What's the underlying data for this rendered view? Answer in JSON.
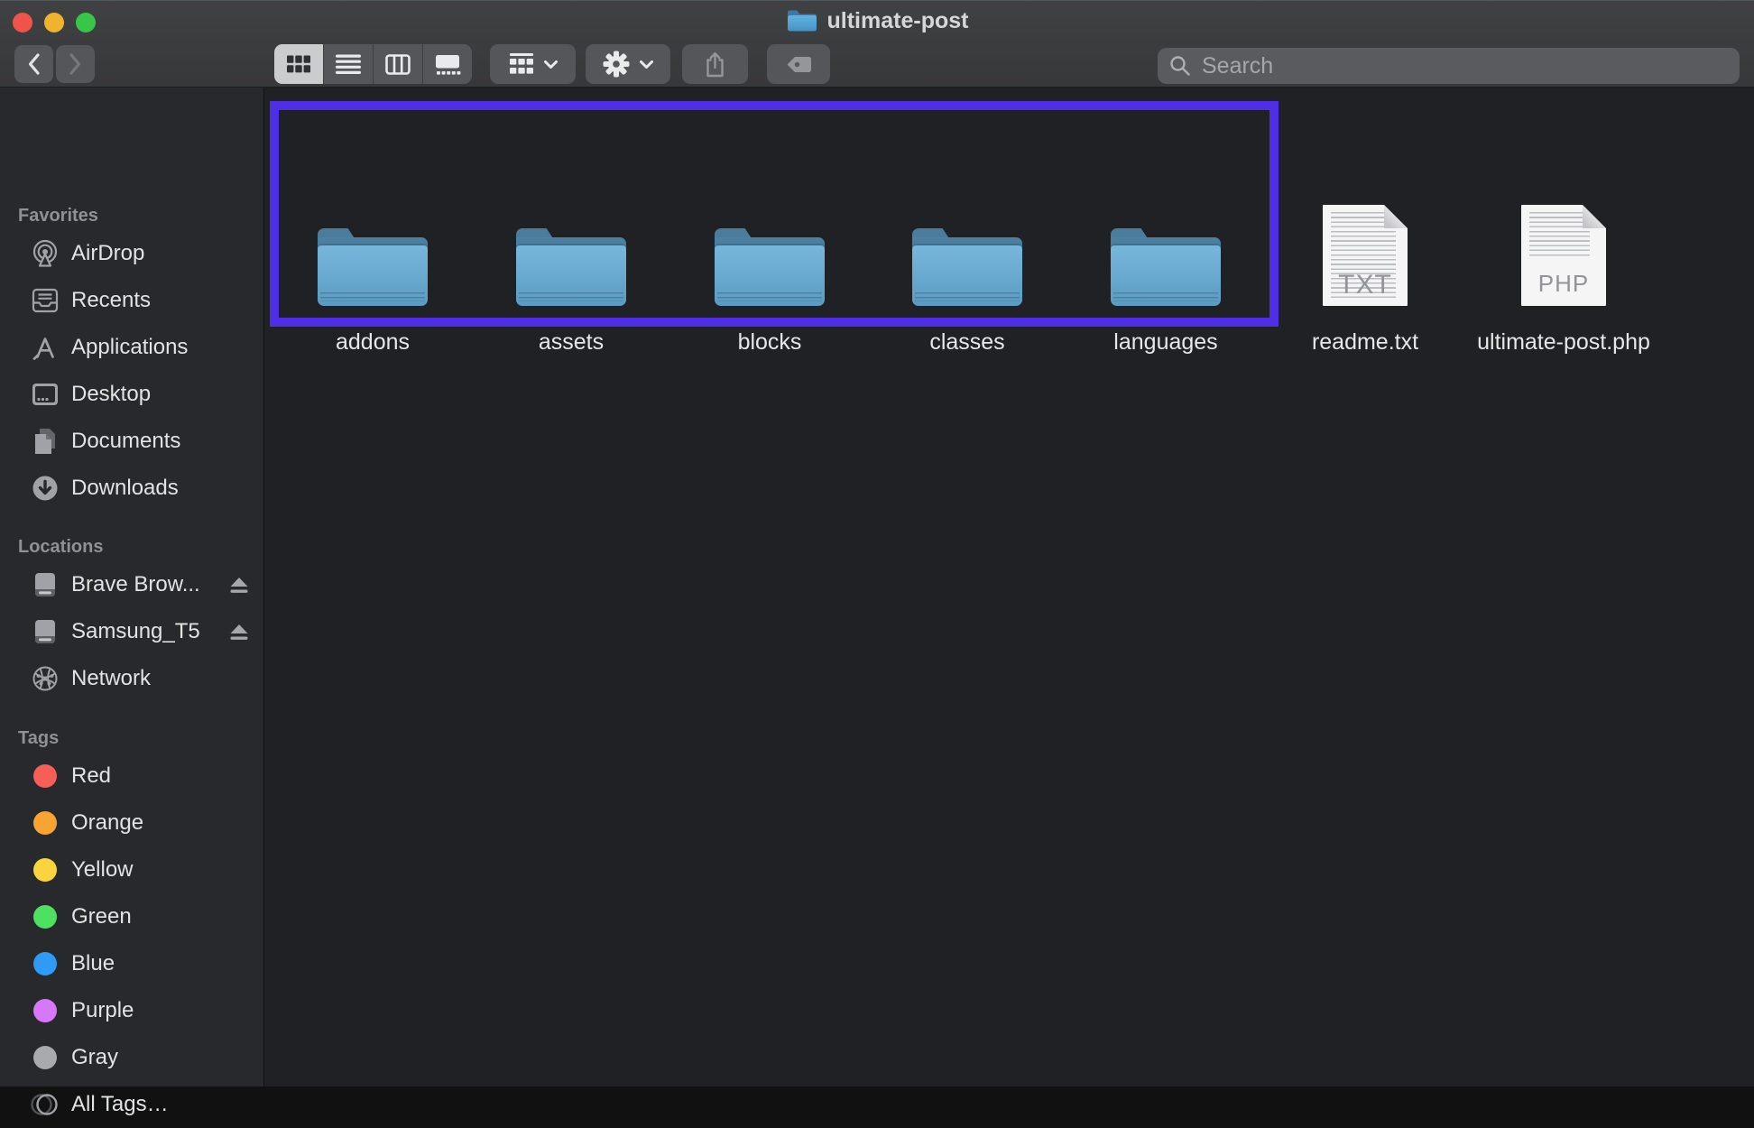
{
  "window": {
    "title": "ultimate-post",
    "traffic_lights": {
      "close": "#ee544a",
      "minimize": "#f0b32e",
      "zoom": "#37c648"
    }
  },
  "toolbar": {
    "view_modes": [
      "icon-view",
      "list-view",
      "column-view",
      "gallery-view"
    ],
    "selected_view": "icon-view",
    "buttons": [
      "group-by",
      "action-gear",
      "share",
      "tag"
    ],
    "search": {
      "placeholder": "Search"
    }
  },
  "sidebar": {
    "sections": [
      {
        "title": "Favorites",
        "items": [
          {
            "label": "AirDrop",
            "icon": "airdrop-icon"
          },
          {
            "label": "Recents",
            "icon": "recents-icon"
          },
          {
            "label": "Applications",
            "icon": "applications-icon"
          },
          {
            "label": "Desktop",
            "icon": "desktop-icon"
          },
          {
            "label": "Documents",
            "icon": "documents-icon"
          },
          {
            "label": "Downloads",
            "icon": "downloads-icon"
          }
        ]
      },
      {
        "title": "Locations",
        "items": [
          {
            "label": "Brave Brow...",
            "icon": "drive-icon",
            "ejectable": true
          },
          {
            "label": "Samsung_T5",
            "icon": "drive-icon",
            "ejectable": true
          },
          {
            "label": "Network",
            "icon": "globe-icon",
            "ejectable": false
          }
        ]
      },
      {
        "title": "Tags",
        "items": [
          {
            "label": "Red",
            "color": "#f65f57"
          },
          {
            "label": "Orange",
            "color": "#f7a432"
          },
          {
            "label": "Yellow",
            "color": "#f9d43c"
          },
          {
            "label": "Green",
            "color": "#4ee061"
          },
          {
            "label": "Blue",
            "color": "#2e9bf7"
          },
          {
            "label": "Purple",
            "color": "#d678f9"
          },
          {
            "label": "Gray",
            "color": "#a9aaad"
          },
          {
            "label": "All Tags…",
            "color": ""
          }
        ]
      }
    ]
  },
  "content": {
    "selection_color": "#4f2fe5",
    "folders": [
      "addons",
      "assets",
      "blocks",
      "classes",
      "languages"
    ],
    "files": [
      {
        "name": "readme.txt",
        "ext": "TXT"
      },
      {
        "name": "ultimate-post.php",
        "ext": "PHP"
      }
    ]
  }
}
